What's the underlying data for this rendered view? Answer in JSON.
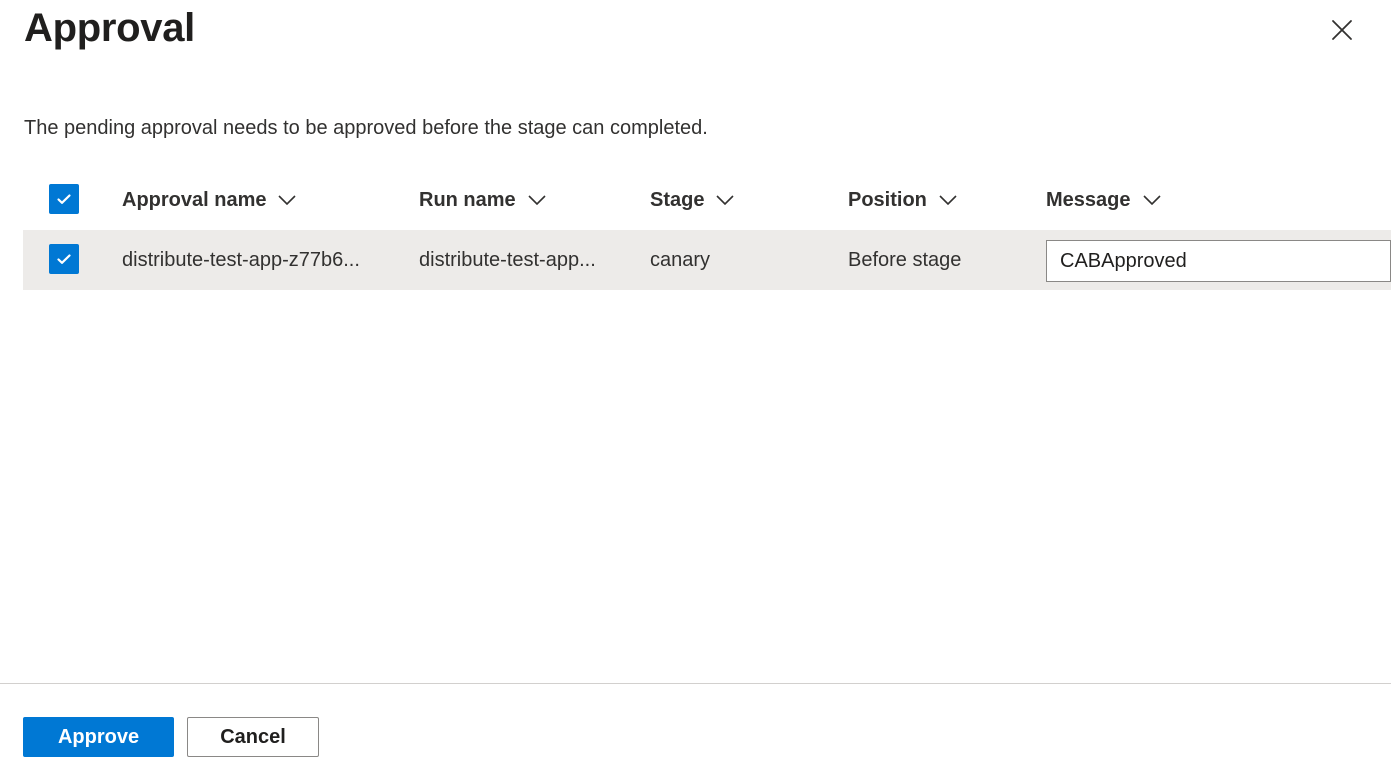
{
  "dialog": {
    "title": "Approval",
    "description": "The pending approval needs to be approved before the stage can completed."
  },
  "table": {
    "columns": [
      {
        "label": "Approval name"
      },
      {
        "label": "Run name"
      },
      {
        "label": "Stage"
      },
      {
        "label": "Position"
      },
      {
        "label": "Message"
      }
    ],
    "select_all_checked": true,
    "rows": [
      {
        "checked": true,
        "approval_name": "distribute-test-app-z77b6...",
        "run_name": "distribute-test-app...",
        "stage": "canary",
        "position": "Before stage",
        "message": "CABApproved"
      }
    ]
  },
  "footer": {
    "approve_label": "Approve",
    "cancel_label": "Cancel"
  },
  "colors": {
    "accent": "#0078d4",
    "row_selected_bg": "#edebe9"
  },
  "icons": {
    "close": "close-icon",
    "sort": "chevron-down-icon",
    "check": "checkmark-icon"
  }
}
